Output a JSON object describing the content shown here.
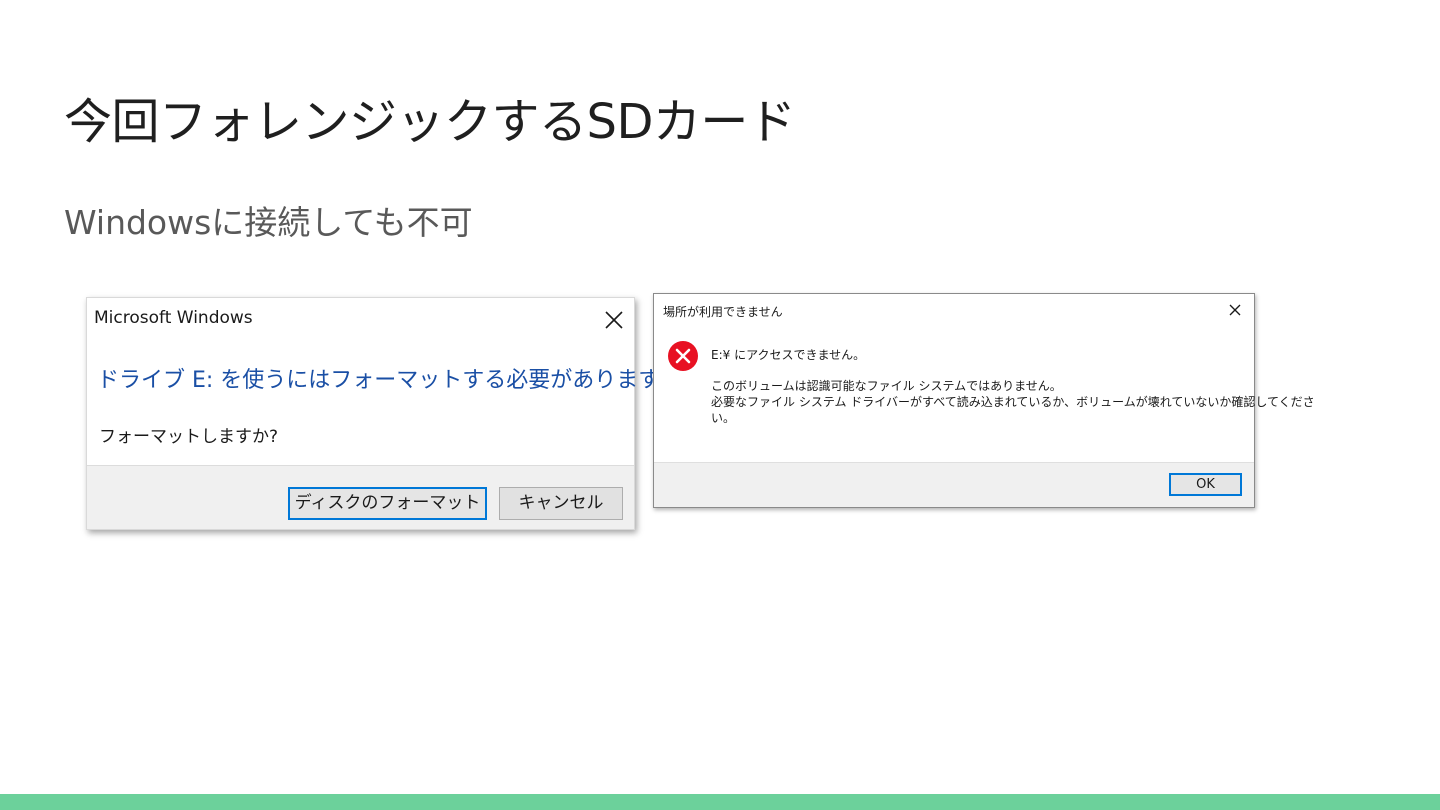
{
  "slide": {
    "title": "今回フォレンジックするSDカード",
    "subtitle": "Windowsに接続しても不可"
  },
  "format_dialog": {
    "title": "Microsoft Windows",
    "close_icon": "close-icon",
    "instruction": "ドライブ E: を使うにはフォーマットする必要があります。",
    "question": "フォーマットしますか?",
    "format_button": "ディスクのフォーマット",
    "cancel_button": "キャンセル",
    "instruction_color": "#1a4fa5"
  },
  "location_dialog": {
    "title": "場所が利用できません",
    "close_icon": "close-icon",
    "error_icon": "error-icon",
    "error_color": "#e81123",
    "message": "E:¥ にアクセスできません。",
    "detail_line1": "このボリュームは認識可能なファイル システムではありません。",
    "detail_line2": "必要なファイル システム ドライバーがすべて読み込まれているか、ボリュームが壊れていないか確認してくださ",
    "detail_line3": "い。",
    "ok_button": "OK"
  },
  "theme": {
    "accent_bar": "#6cd19b",
    "default_button_border": "#0078d7"
  }
}
